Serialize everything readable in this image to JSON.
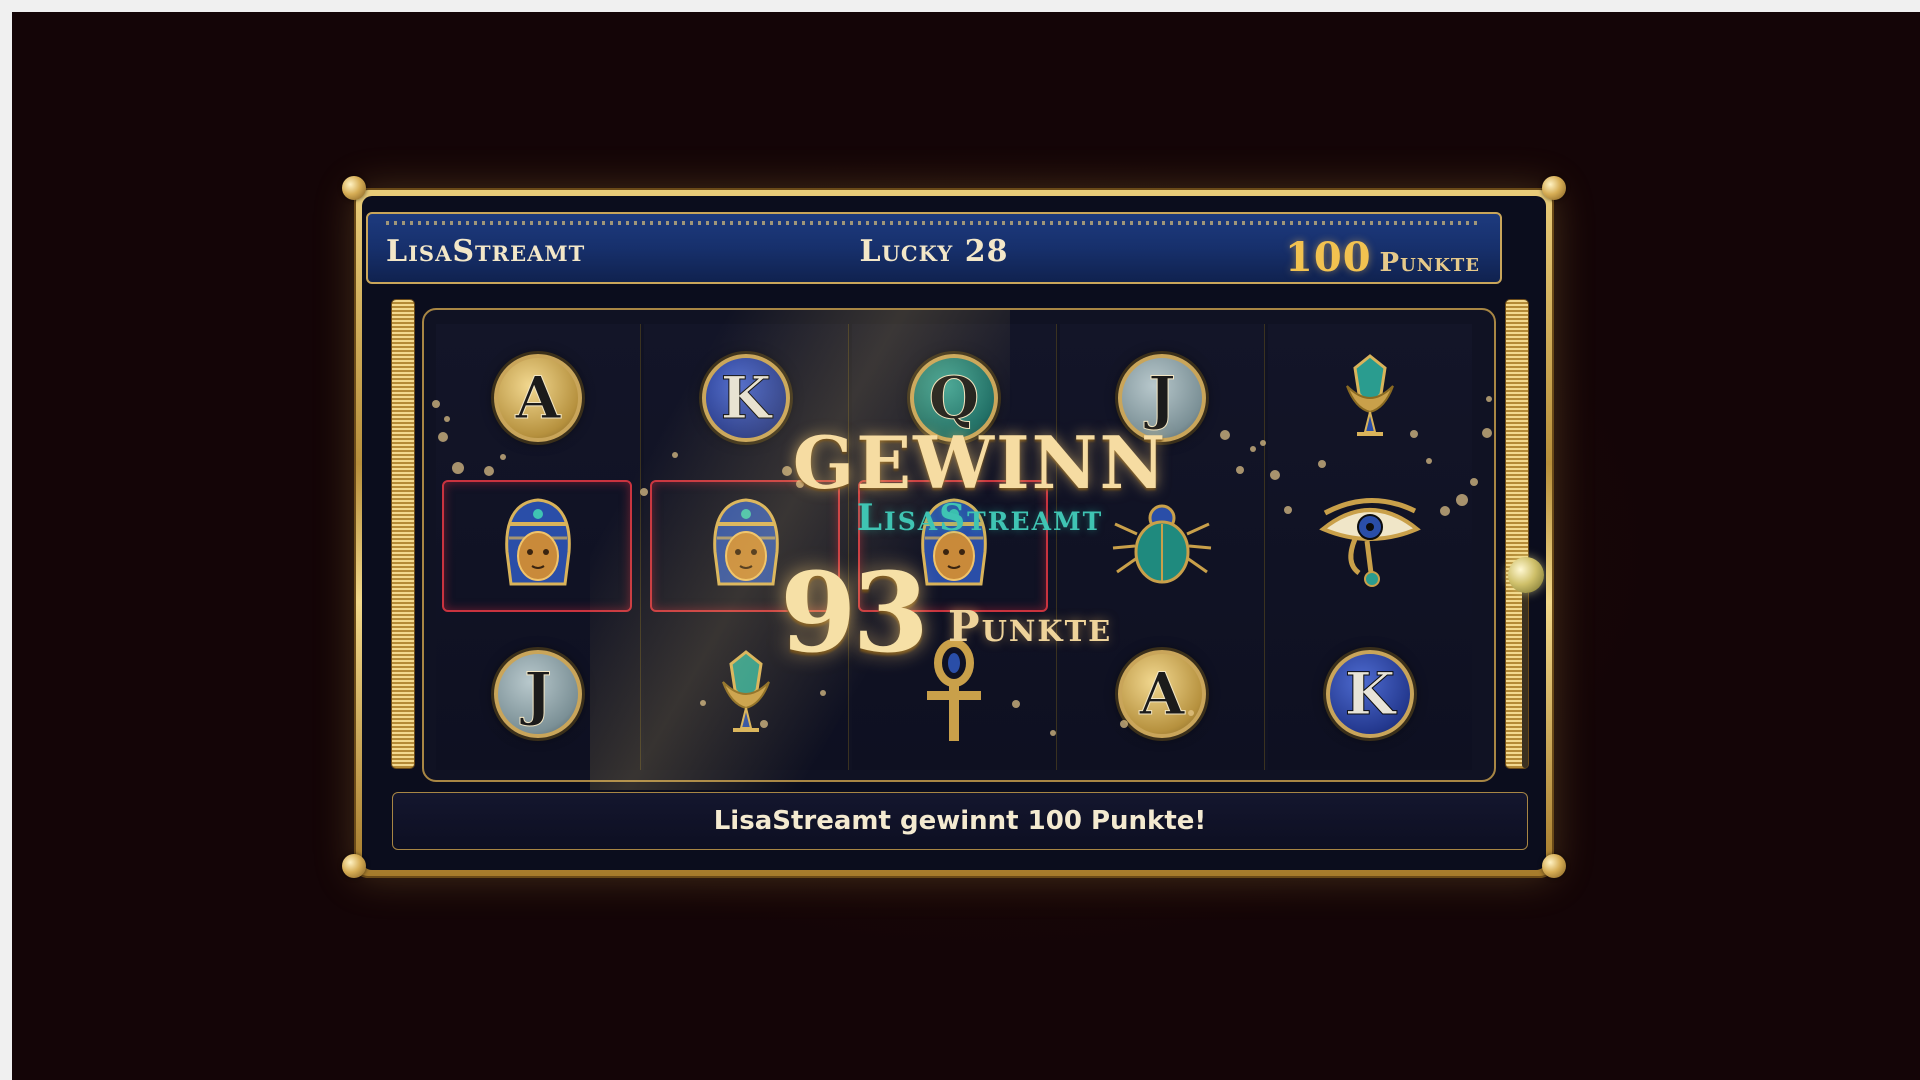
{
  "header": {
    "player_name": "LisaStreamt",
    "game_title": "Lucky 28",
    "score_value": "100",
    "score_unit": "Punkte"
  },
  "reels": [
    [
      {
        "kind": "coin",
        "label": "A",
        "tone": "gold"
      },
      {
        "kind": "icon",
        "icon": "pharaoh-mask-icon",
        "winning": true
      },
      {
        "kind": "coin",
        "label": "J",
        "tone": "silver"
      }
    ],
    [
      {
        "kind": "coin",
        "label": "K",
        "tone": "blue"
      },
      {
        "kind": "icon",
        "icon": "pharaoh-mask-icon",
        "winning": true
      },
      {
        "kind": "icon",
        "icon": "lotus-icon"
      }
    ],
    [
      {
        "kind": "coin",
        "label": "Q",
        "tone": "teal"
      },
      {
        "kind": "icon",
        "icon": "pharaoh-mask-icon",
        "winning": true
      },
      {
        "kind": "icon",
        "icon": "ankh-icon"
      }
    ],
    [
      {
        "kind": "coin",
        "label": "J",
        "tone": "silver"
      },
      {
        "kind": "icon",
        "icon": "scarab-icon"
      },
      {
        "kind": "coin",
        "label": "A",
        "tone": "gold"
      }
    ],
    [
      {
        "kind": "icon",
        "icon": "lotus-icon"
      },
      {
        "kind": "icon",
        "icon": "eye-of-horus-icon"
      },
      {
        "kind": "coin",
        "label": "K",
        "tone": "blue"
      }
    ]
  ],
  "win": {
    "title": "GEWINN",
    "player": "LisaStreamt",
    "amount": "93",
    "unit": "Punkte"
  },
  "message": "LisaStreamt gewinnt 100 Punkte!",
  "colors": {
    "background": "#140507",
    "gold": "#c9a55a",
    "header_blue": "#17306c",
    "teal": "#3fc4b3",
    "win_highlight": "#c9333f"
  }
}
